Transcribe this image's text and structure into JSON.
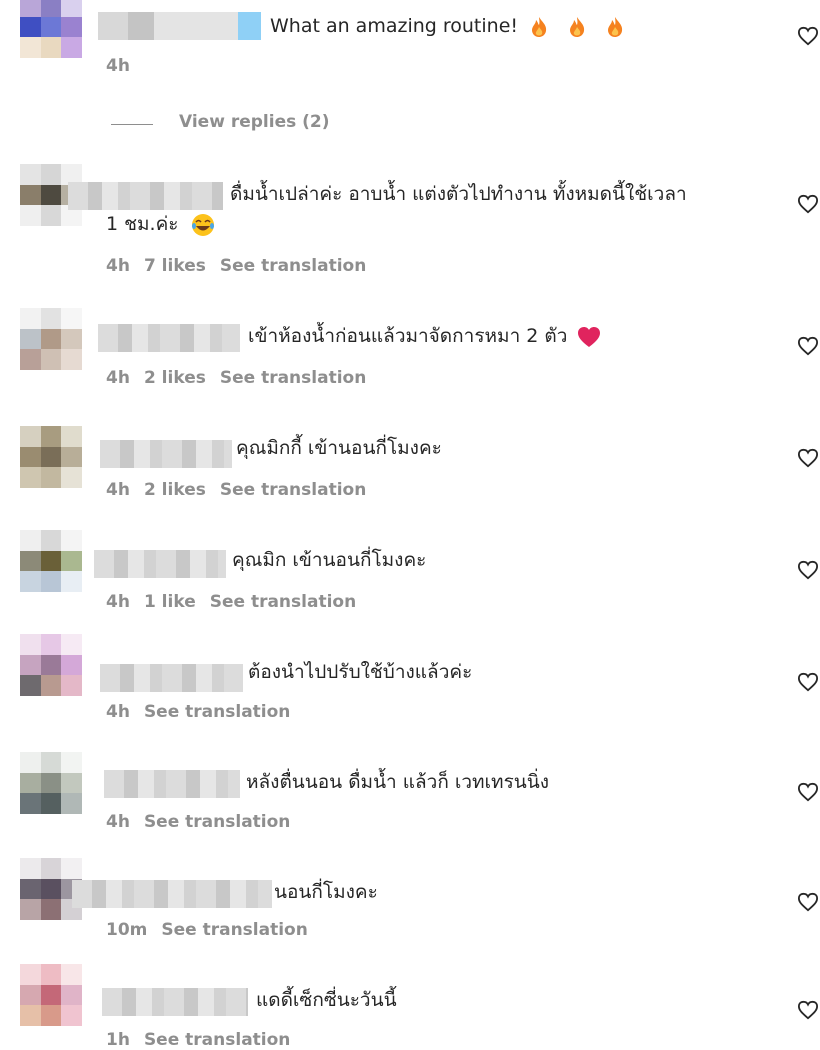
{
  "view_replies": "View replies (2)",
  "comments": [
    {
      "text": "What an amazing routine!",
      "time": "4h",
      "likes": "",
      "translate": "",
      "emoji": "fire x3"
    },
    {
      "text": "ดื่มน้ำเปล่าค่ะ อาบน้ำ แต่งตัวไปทำงาน ทั้งหมดนี้ใช้เวลา",
      "text2": "1 ชม.ค่ะ",
      "time": "4h",
      "likes": "7 likes",
      "translate": "See translation"
    },
    {
      "text": "เข้าห้องน้ำก่อนแล้วมาจัดการหมา 2 ตัว",
      "time": "4h",
      "likes": "2 likes",
      "translate": "See translation"
    },
    {
      "text": "คุณมิกกี้ เข้านอนกี่โมงคะ",
      "time": "4h",
      "likes": "2 likes",
      "translate": "See translation"
    },
    {
      "text": "คุณมิก เข้านอนกี่โมงคะ",
      "time": "4h",
      "likes": "1 like",
      "translate": "See translation"
    },
    {
      "text": "ต้องนำไปปรับใช้บ้างแล้วค่ะ",
      "time": "4h",
      "likes": "",
      "translate": "See translation"
    },
    {
      "text": "หลังตื่นนอน ดื่มน้ำ แล้วก็ เวทเทรนนิ่ง",
      "time": "4h",
      "likes": "",
      "translate": "See translation"
    },
    {
      "text": "นอนกี่โมงคะ",
      "time": "10m",
      "likes": "",
      "translate": "See translation"
    },
    {
      "text": "แดดี้เซ็กซี่นะวันนี้",
      "time": "1h",
      "likes": "",
      "translate": "See translation"
    }
  ],
  "icons": {
    "like": "heart-outline-icon",
    "fire": "fire-emoji-icon",
    "red_heart": "red-heart-emoji-icon",
    "laugh": "laughing-emoji-icon"
  },
  "colors": {
    "muted": "#8e8e8e",
    "text": "#262626",
    "fire": "#f5821f",
    "heart": "#e0245e"
  }
}
